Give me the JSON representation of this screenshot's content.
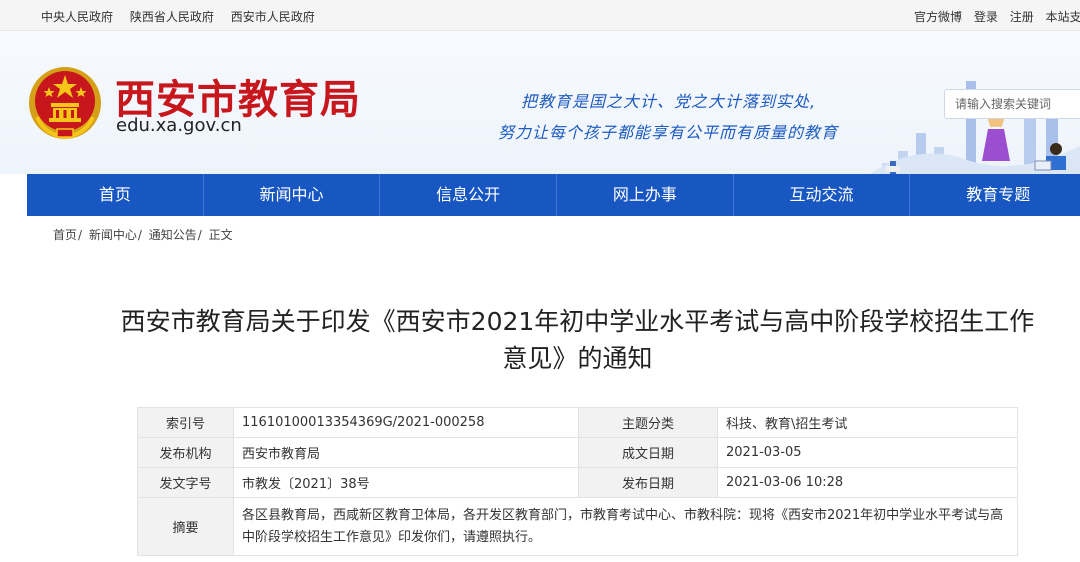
{
  "topbar": {
    "links": [
      "中央人民政府",
      "陕西省人民政府",
      "西安市人民政府"
    ],
    "right": [
      "官方微博",
      "登录",
      "注册",
      "本站支"
    ]
  },
  "header": {
    "title": "西安市教育局",
    "url": "edu.xa.gov.cn",
    "slogan_line1": "把教育是国之大计、党之大计落到实处,",
    "slogan_line2": "努力让每个孩子都能享有公平而有质量的教育",
    "search_placeholder": "请输入搜索关键词"
  },
  "nav": [
    "首页",
    "新闻中心",
    "信息公开",
    "网上办事",
    "互动交流",
    "教育专题"
  ],
  "breadcrumb": [
    "首页",
    "新闻中心",
    "通知公告",
    "正文"
  ],
  "article": {
    "title": "西安市教育局关于印发《西安市2021年初中学业水平考试与高中阶段学校招生工作意见》的通知"
  },
  "meta": {
    "index_label": "索引号",
    "index_value": "11610100013354369G/2021-000258",
    "topic_label": "主题分类",
    "topic_value": "科技、教育\\招生考试",
    "issuer_label": "发布机构",
    "issuer_value": "西安市教育局",
    "created_label": "成文日期",
    "created_value": "2021-03-05",
    "docno_label": "发文字号",
    "docno_value": "市教发〔2021〕38号",
    "published_label": "发布日期",
    "published_value": "2021-03-06 10:28",
    "summary_label": "摘要",
    "summary_value": "各区县教育局，西咸新区教育卫体局，各开发区教育部门，市教育考试中心、市教科院：现将《西安市2021年初中学业水平考试与高中阶段学校招生工作意见》印发你们，请遵照执行。"
  },
  "colors": {
    "brand_blue": "#1857c2",
    "title_red": "#c8161d"
  }
}
